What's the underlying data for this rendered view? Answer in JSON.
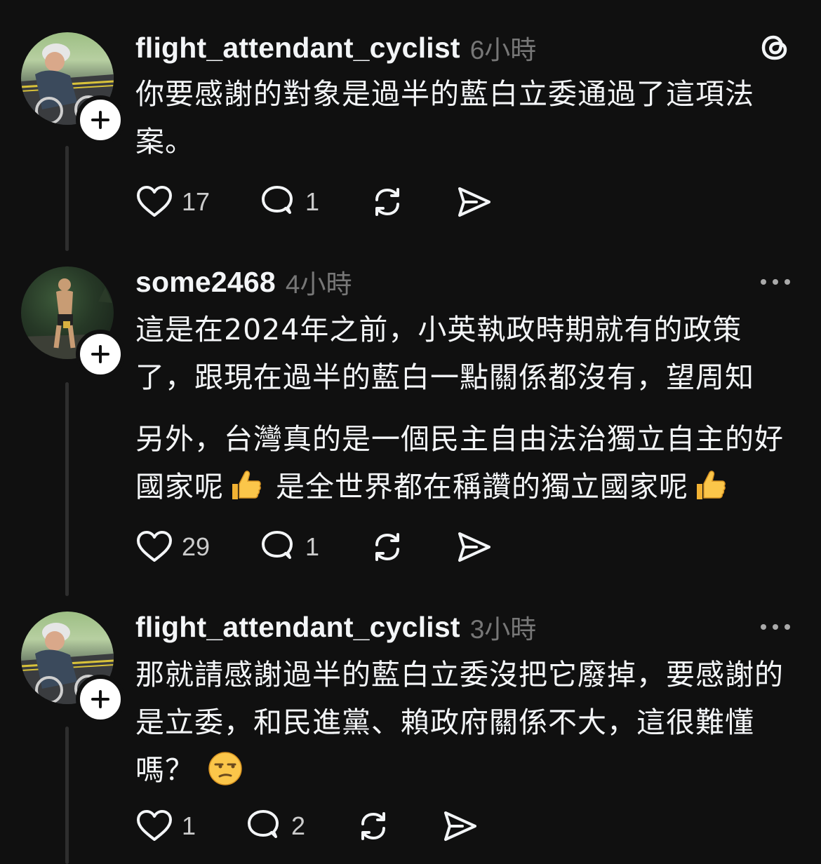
{
  "posts": [
    {
      "username": "flight_attendant_cyclist",
      "time": "6小時",
      "paragraphs": [
        "你要感謝的對象是過半的藍白立委通過了這項法案。"
      ],
      "likes": "17",
      "replies": "1",
      "header_icon": "threads-logo-icon"
    },
    {
      "username": "some2468",
      "time": "4小時",
      "paragraphs": [
        "這是在2024年之前，小英執政時期就有的政策了，跟現在過半的藍白一點關係都沒有，望周知",
        "另外，台灣真的是一個民主自由法治獨立自主的好國家呢",
        "是全世界都在稱讚的獨立國家呢"
      ],
      "emojis": [
        "thumbs-up-icon",
        "thumbs-up-icon"
      ],
      "likes": "29",
      "replies": "1",
      "header_icon": "more-options-icon"
    },
    {
      "username": "flight_attendant_cyclist",
      "time": "3小時",
      "paragraphs": [
        "那就請感謝過半的藍白立委沒把它廢掉，要感謝的是立委，和民進黨、賴政府關係不大，這很難懂嗎？"
      ],
      "emojis": [
        "unamused-face-icon"
      ],
      "likes": "1",
      "replies": "2",
      "header_icon": "more-options-icon"
    }
  ],
  "colors": {
    "background": "#101010",
    "text": "#f3f5f7",
    "muted": "#777777",
    "thread_line": "#2e2e2e"
  }
}
